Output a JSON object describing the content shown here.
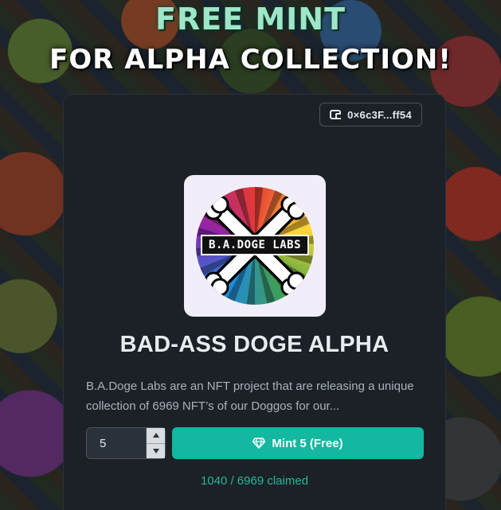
{
  "header": {
    "line1": "FREE MINT",
    "line2": "FOR ALPHA COLLECTION!"
  },
  "wallet": {
    "icon": "wallet-icon",
    "address": "0×6c3F...ff54"
  },
  "project": {
    "logo_text": "B.A.DOGE LABS",
    "title": "BAD-ASS DOGE ALPHA",
    "description": "B.A.Doge Labs are an NFT project that are releasing a unique collection of 6969 NFT’s of our Doggos for our..."
  },
  "mint": {
    "quantity": "5",
    "button_label": "Mint 5 (Free)",
    "button_icon": "diamond-icon",
    "claimed_text": "1040 / 6969 claimed"
  },
  "colors": {
    "card_bg": "#1c2128",
    "accent": "#14b7a0",
    "claimed_text": "#22b895",
    "heading_mint": "#9fe6c9"
  }
}
